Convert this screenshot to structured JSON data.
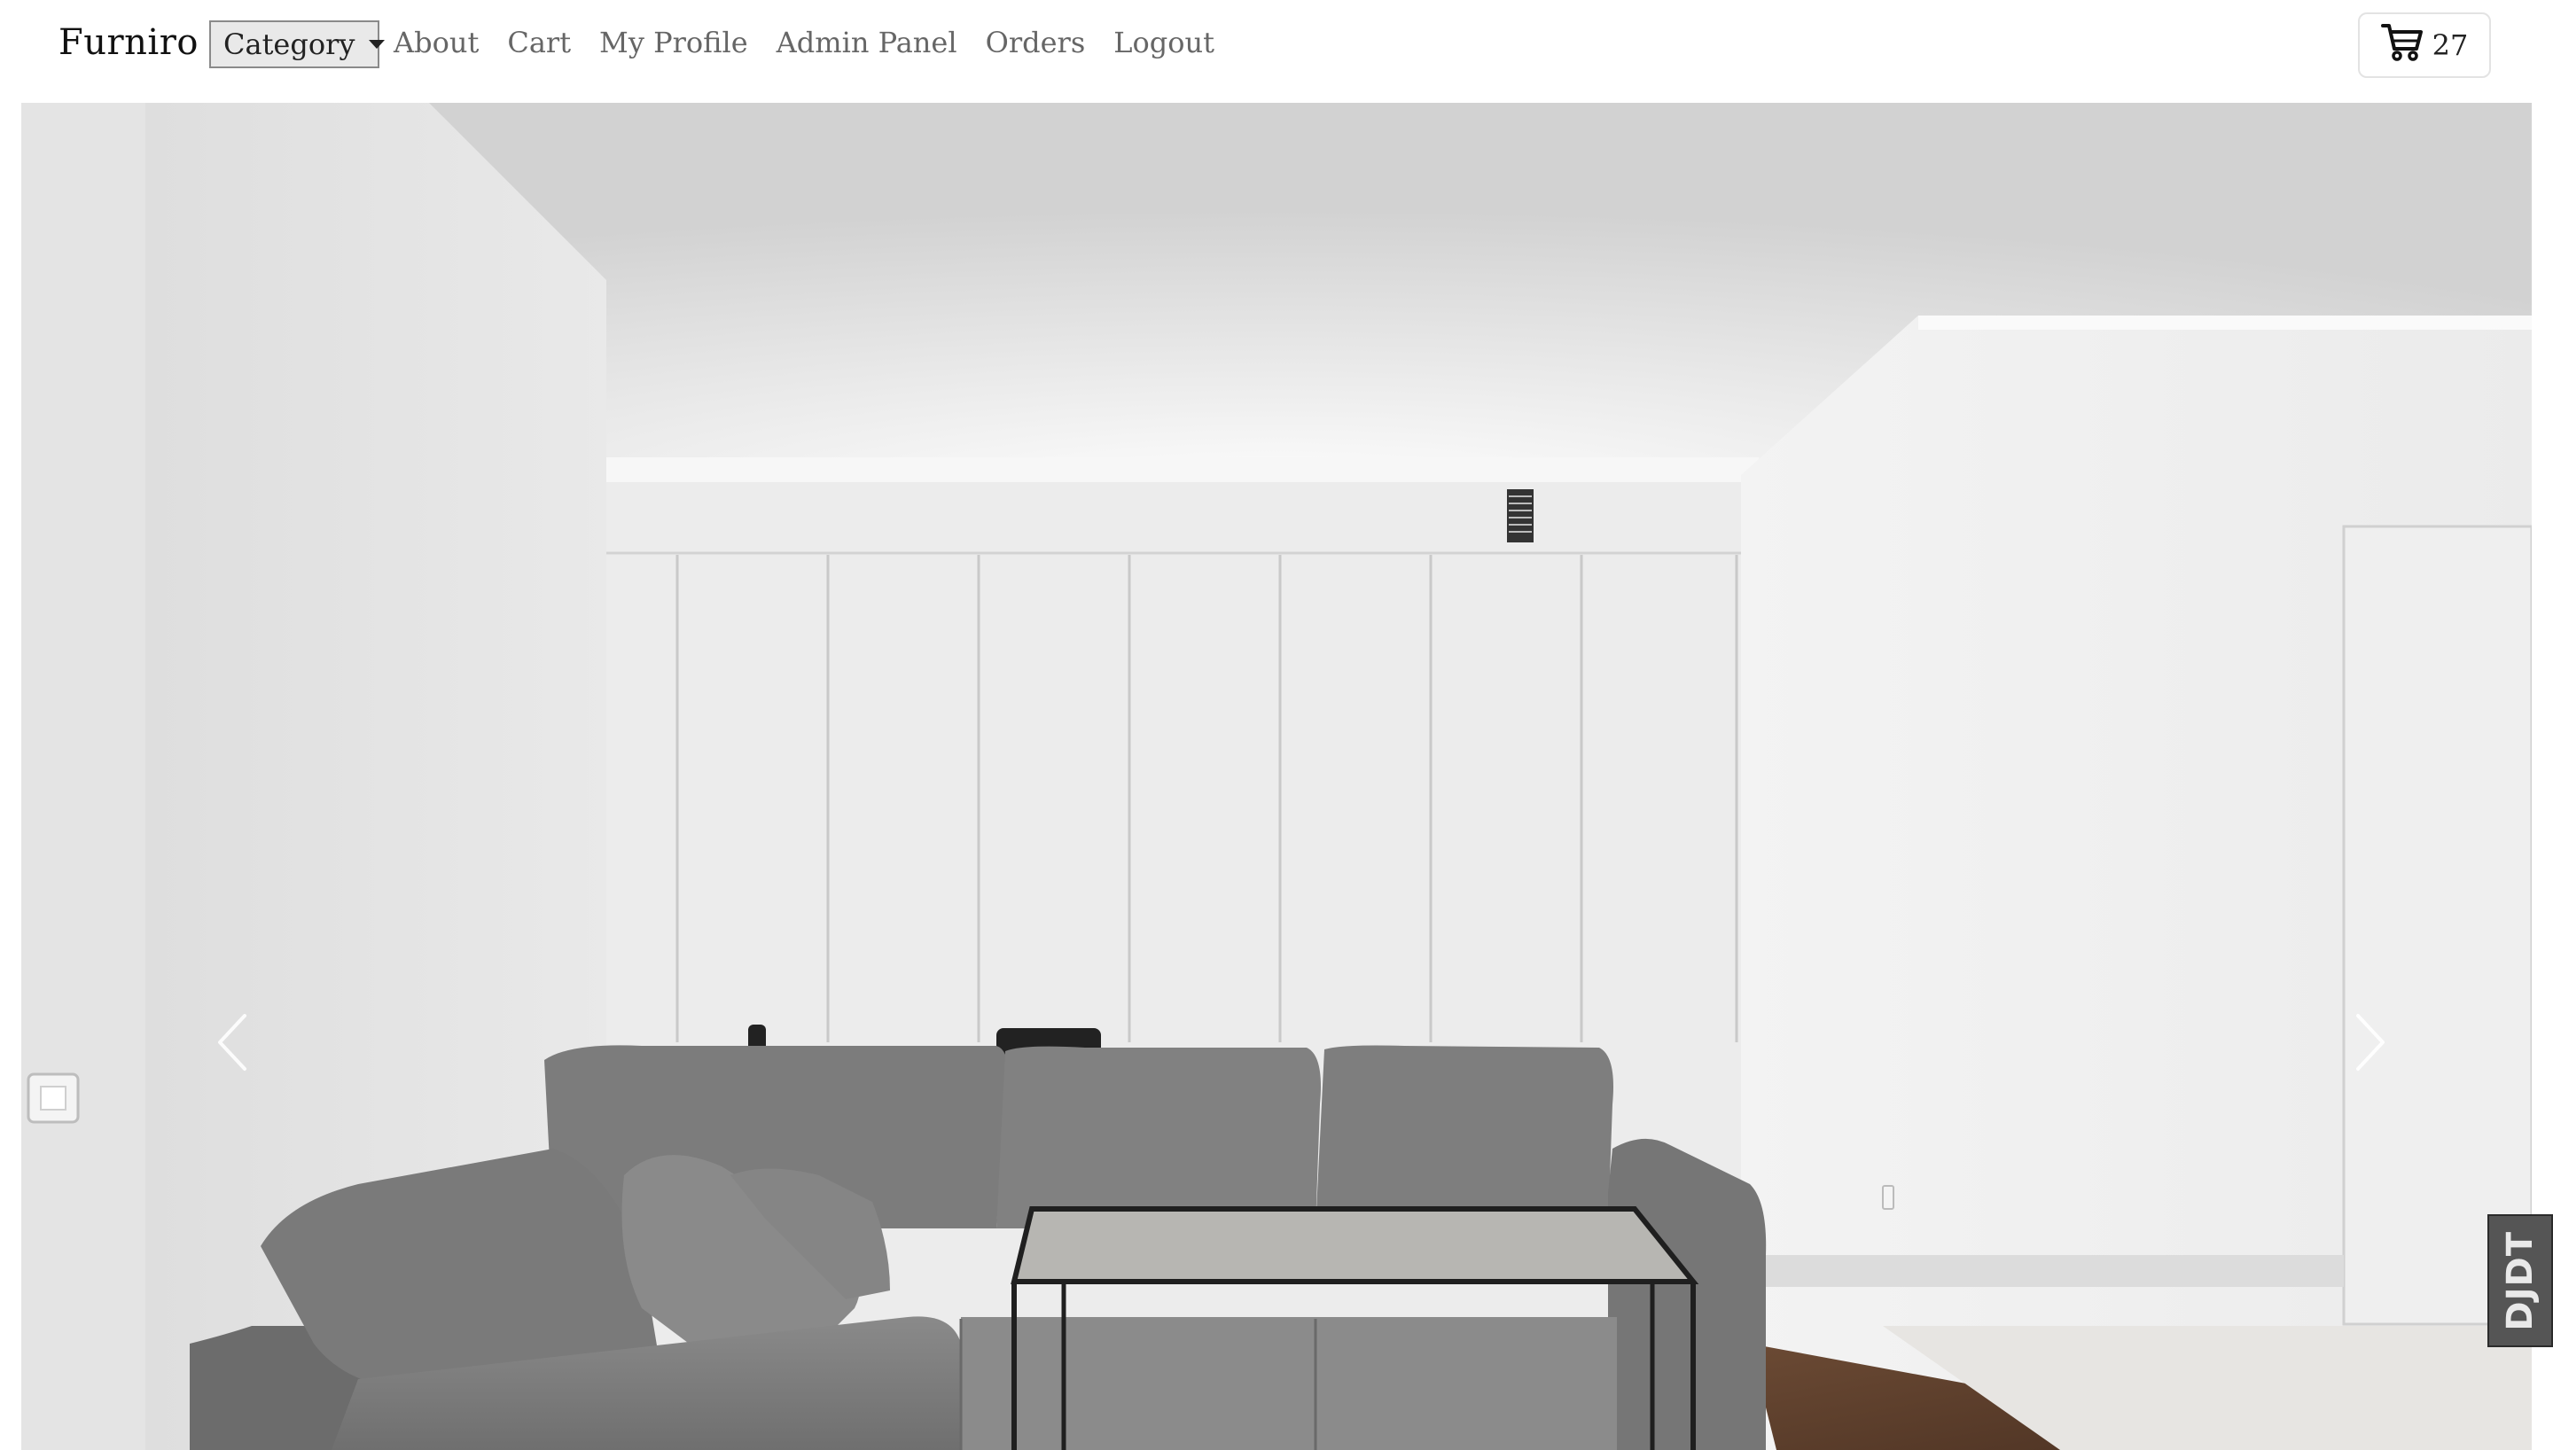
{
  "navbar": {
    "brand": "Furniro",
    "category_label": "Category",
    "links": [
      "About",
      "Cart",
      "My Profile",
      "Admin Panel",
      "Orders",
      "Logout"
    ],
    "cart_count": "27"
  },
  "carousel": {
    "slide_image": "living-room-grey-sofa"
  },
  "debug_toolbar": {
    "label": "DJDT"
  }
}
